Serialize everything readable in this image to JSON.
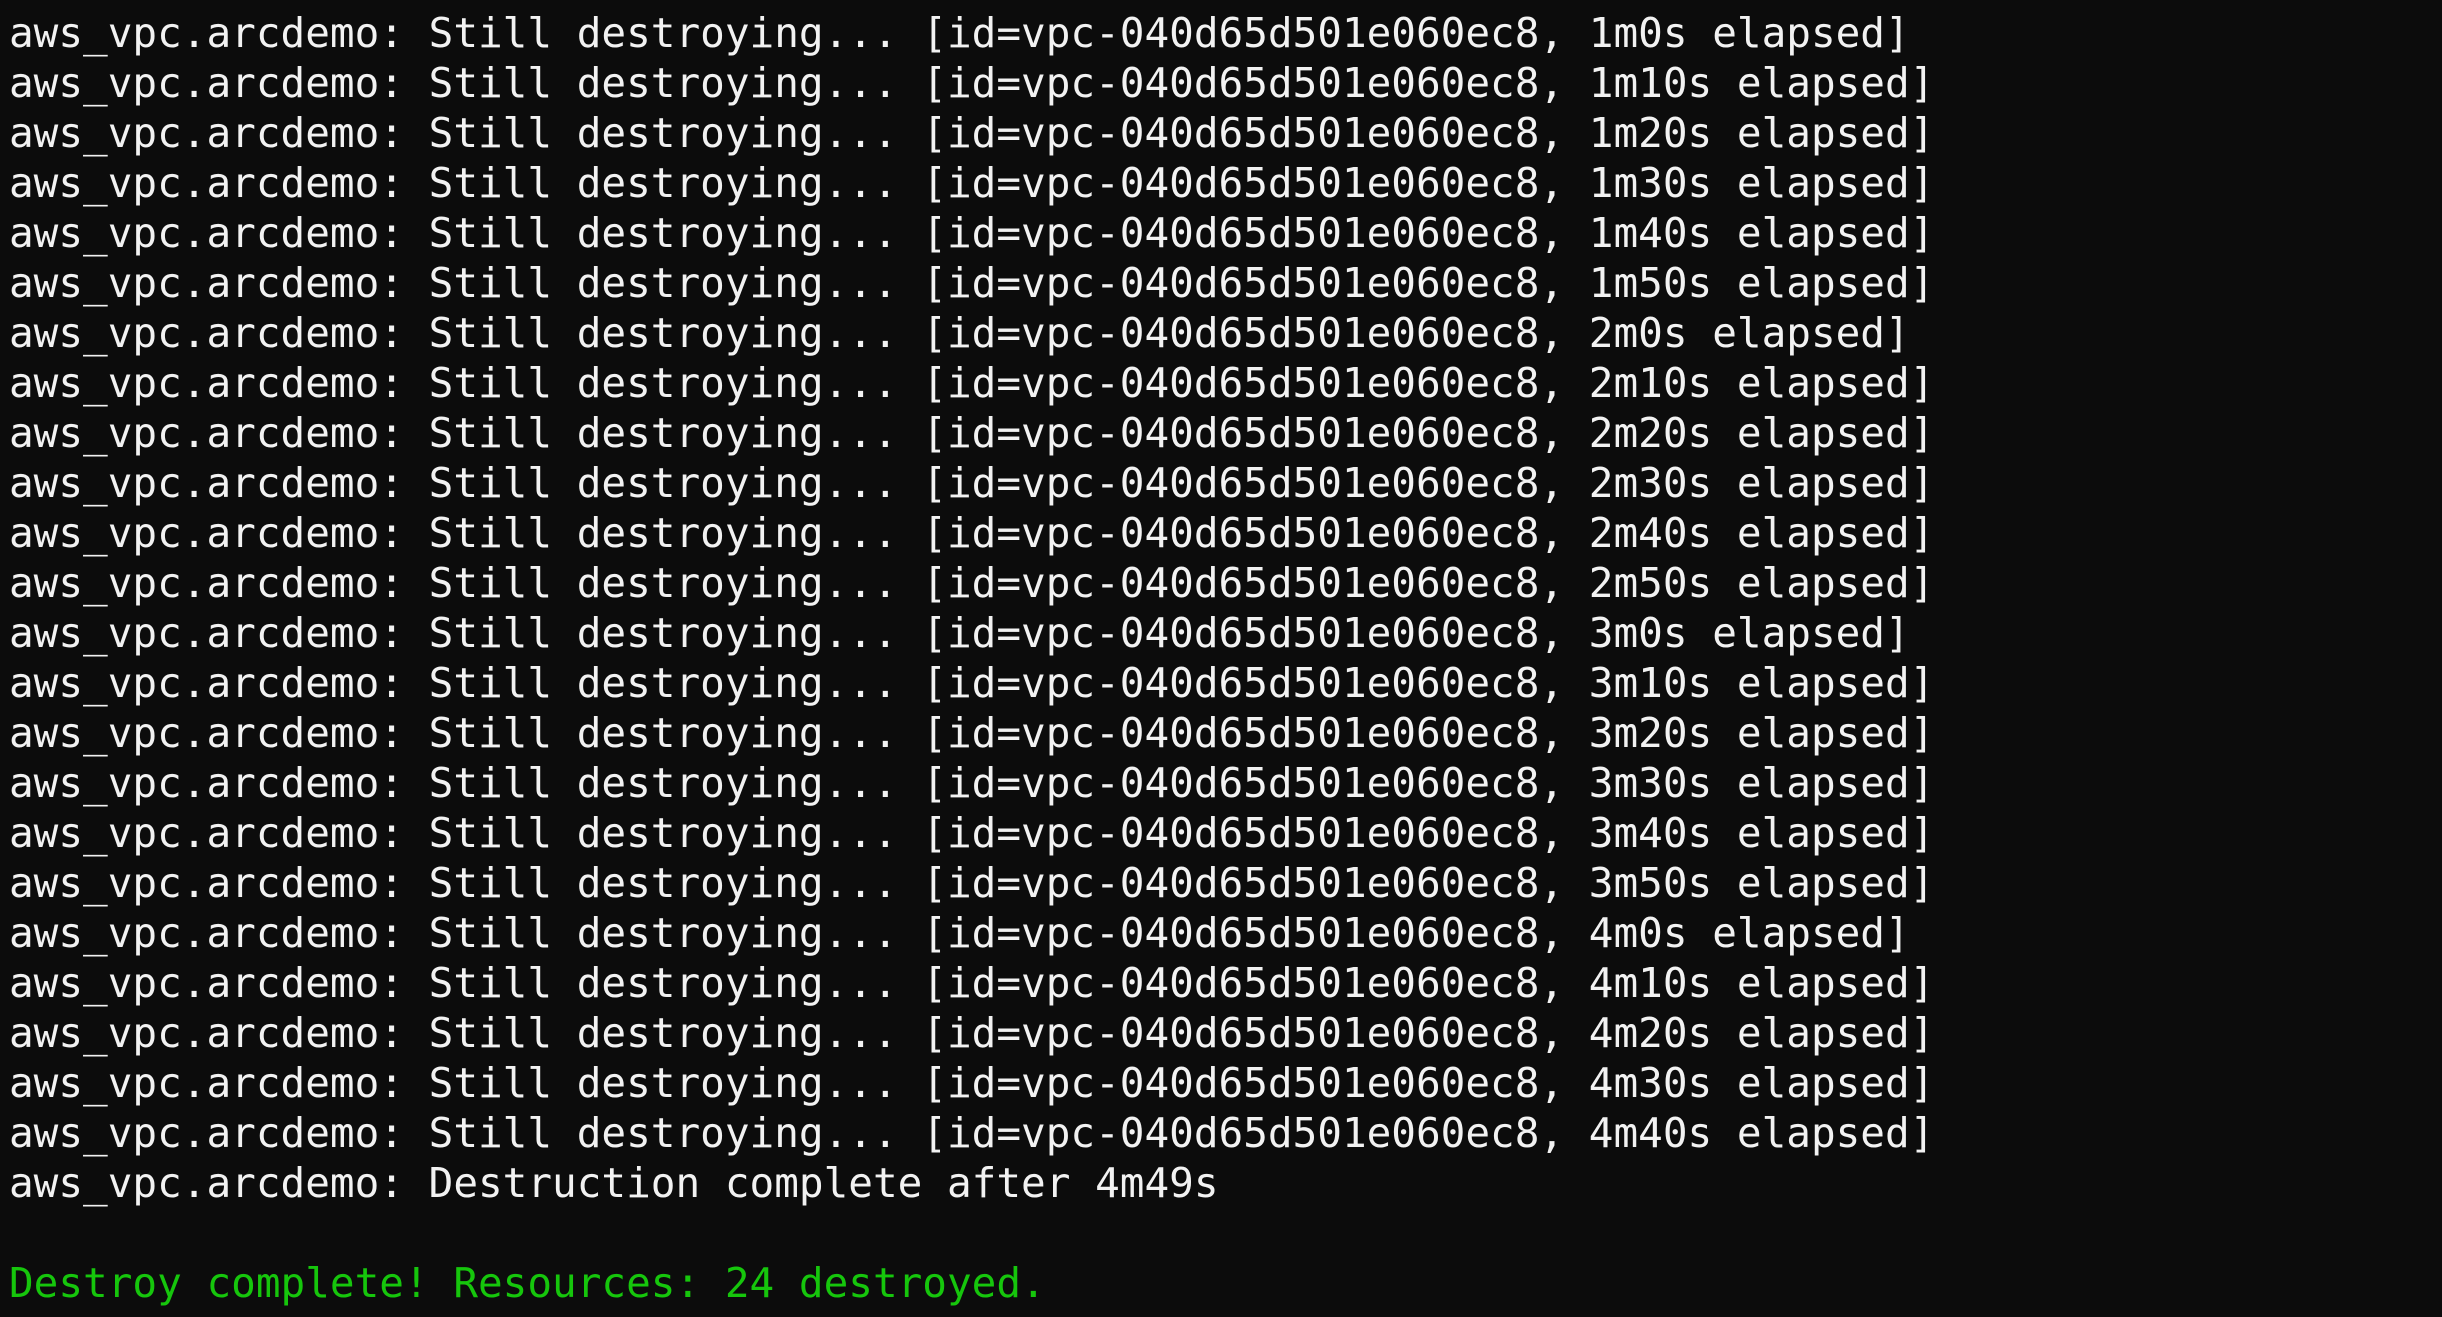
{
  "terminal": {
    "colors": {
      "background": "#0c0c0c",
      "foreground": "#f2f2f2",
      "success": "#16c60c"
    },
    "lines": [
      {
        "text": "aws_vpc.arcdemo: Still destroying... [id=vpc-040d65d501e060ec8, 1m0s elapsed]",
        "kind": "normal"
      },
      {
        "text": "aws_vpc.arcdemo: Still destroying... [id=vpc-040d65d501e060ec8, 1m10s elapsed]",
        "kind": "normal"
      },
      {
        "text": "aws_vpc.arcdemo: Still destroying... [id=vpc-040d65d501e060ec8, 1m20s elapsed]",
        "kind": "normal"
      },
      {
        "text": "aws_vpc.arcdemo: Still destroying... [id=vpc-040d65d501e060ec8, 1m30s elapsed]",
        "kind": "normal"
      },
      {
        "text": "aws_vpc.arcdemo: Still destroying... [id=vpc-040d65d501e060ec8, 1m40s elapsed]",
        "kind": "normal"
      },
      {
        "text": "aws_vpc.arcdemo: Still destroying... [id=vpc-040d65d501e060ec8, 1m50s elapsed]",
        "kind": "normal"
      },
      {
        "text": "aws_vpc.arcdemo: Still destroying... [id=vpc-040d65d501e060ec8, 2m0s elapsed]",
        "kind": "normal"
      },
      {
        "text": "aws_vpc.arcdemo: Still destroying... [id=vpc-040d65d501e060ec8, 2m10s elapsed]",
        "kind": "normal"
      },
      {
        "text": "aws_vpc.arcdemo: Still destroying... [id=vpc-040d65d501e060ec8, 2m20s elapsed]",
        "kind": "normal"
      },
      {
        "text": "aws_vpc.arcdemo: Still destroying... [id=vpc-040d65d501e060ec8, 2m30s elapsed]",
        "kind": "normal"
      },
      {
        "text": "aws_vpc.arcdemo: Still destroying... [id=vpc-040d65d501e060ec8, 2m40s elapsed]",
        "kind": "normal"
      },
      {
        "text": "aws_vpc.arcdemo: Still destroying... [id=vpc-040d65d501e060ec8, 2m50s elapsed]",
        "kind": "normal"
      },
      {
        "text": "aws_vpc.arcdemo: Still destroying... [id=vpc-040d65d501e060ec8, 3m0s elapsed]",
        "kind": "normal"
      },
      {
        "text": "aws_vpc.arcdemo: Still destroying... [id=vpc-040d65d501e060ec8, 3m10s elapsed]",
        "kind": "normal"
      },
      {
        "text": "aws_vpc.arcdemo: Still destroying... [id=vpc-040d65d501e060ec8, 3m20s elapsed]",
        "kind": "normal"
      },
      {
        "text": "aws_vpc.arcdemo: Still destroying... [id=vpc-040d65d501e060ec8, 3m30s elapsed]",
        "kind": "normal"
      },
      {
        "text": "aws_vpc.arcdemo: Still destroying... [id=vpc-040d65d501e060ec8, 3m40s elapsed]",
        "kind": "normal"
      },
      {
        "text": "aws_vpc.arcdemo: Still destroying... [id=vpc-040d65d501e060ec8, 3m50s elapsed]",
        "kind": "normal"
      },
      {
        "text": "aws_vpc.arcdemo: Still destroying... [id=vpc-040d65d501e060ec8, 4m0s elapsed]",
        "kind": "normal"
      },
      {
        "text": "aws_vpc.arcdemo: Still destroying... [id=vpc-040d65d501e060ec8, 4m10s elapsed]",
        "kind": "normal"
      },
      {
        "text": "aws_vpc.arcdemo: Still destroying... [id=vpc-040d65d501e060ec8, 4m20s elapsed]",
        "kind": "normal"
      },
      {
        "text": "aws_vpc.arcdemo: Still destroying... [id=vpc-040d65d501e060ec8, 4m30s elapsed]",
        "kind": "normal"
      },
      {
        "text": "aws_vpc.arcdemo: Still destroying... [id=vpc-040d65d501e060ec8, 4m40s elapsed]",
        "kind": "normal"
      },
      {
        "text": "aws_vpc.arcdemo: Destruction complete after 4m49s",
        "kind": "normal"
      },
      {
        "text": "",
        "kind": "blank"
      },
      {
        "text": "Destroy complete! Resources: 24 destroyed.",
        "kind": "success"
      }
    ]
  }
}
